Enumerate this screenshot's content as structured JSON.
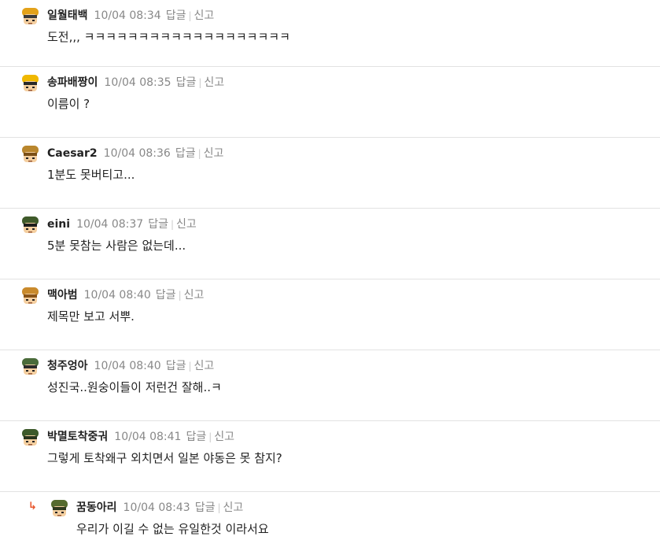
{
  "comments": [
    {
      "nick": "일월태백",
      "time": "10/04 08:34",
      "reply_label": "답글",
      "report_label": "신고",
      "text": "도전,,, ㅋㅋㅋㅋㅋㅋㅋㅋㅋㅋㅋㅋㅋㅋㅋㅋㅋㅋㅋ",
      "avatar_colors": {
        "hair": "#e3a21a",
        "face": "#f4cfa0",
        "band": "#3a3a3a"
      }
    },
    {
      "nick": "송파배짱이",
      "time": "10/04 08:35",
      "reply_label": "답글",
      "report_label": "신고",
      "text": "이름이 ?",
      "avatar_colors": {
        "hair": "#f0b800",
        "face": "#f4cfa0",
        "band": "#2a2a2a"
      }
    },
    {
      "nick": "Caesar2",
      "time": "10/04 08:36",
      "reply_label": "답글",
      "report_label": "신고",
      "text": "1분도 못버티고...",
      "avatar_colors": {
        "hair": "#b9862d",
        "face": "#f4cfa0",
        "band": "#7a4f17"
      }
    },
    {
      "nick": "eini",
      "time": "10/04 08:37",
      "reply_label": "답글",
      "report_label": "신고",
      "text": "5분 못참는 사람은 없는데...",
      "avatar_colors": {
        "hair": "#3f5a2a",
        "face": "#f4cfa0",
        "band": "#1d1d1d"
      }
    },
    {
      "nick": "맥아범",
      "time": "10/04 08:40",
      "reply_label": "답글",
      "report_label": "신고",
      "text": "제목만 보고 서뿌.",
      "avatar_colors": {
        "hair": "#c98a2c",
        "face": "#f4cfa0",
        "band": "#8a5418"
      }
    },
    {
      "nick": "청주엉아",
      "time": "10/04 08:40",
      "reply_label": "답글",
      "report_label": "신고",
      "text": "성진국..원숭이들이 저런건 잘해..ㅋ",
      "avatar_colors": {
        "hair": "#4a6b3a",
        "face": "#f4cfa0",
        "band": "#2b2b2b"
      }
    },
    {
      "nick": "박멸토착중궈",
      "time": "10/04 08:41",
      "reply_label": "답글",
      "report_label": "신고",
      "text": "그렇게 토착왜구 외치면서 일본 야동은 못 참지?",
      "avatar_colors": {
        "hair": "#3d5a2b",
        "face": "#f4cfa0",
        "band": "#27341d"
      }
    }
  ],
  "reply": {
    "nick": "꿈동아리",
    "time": "10/04 08:43",
    "reply_label": "답글",
    "report_label": "신고",
    "text": "우리가 이길 수 없는 유일한것 이라서요",
    "arrow": "↳",
    "avatar_colors": {
      "hair": "#556b2f",
      "face": "#f4cfa0",
      "band": "#2f3a1f"
    }
  }
}
